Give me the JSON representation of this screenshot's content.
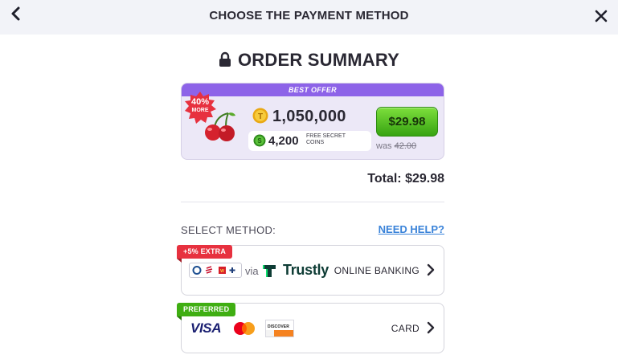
{
  "header": {
    "title": "CHOOSE THE PAYMENT METHOD",
    "back_icon": "chevron-left-icon",
    "close_icon": "close-icon"
  },
  "summary": {
    "title": "ORDER SUMMARY",
    "lock_icon": "lock-icon"
  },
  "offer": {
    "banner": "BEST OFFER",
    "promo_percent": "40%",
    "promo_more": "MORE",
    "coins": "1,050,000",
    "bonus_coins": "4,200",
    "bonus_label": "FREE SECRET COINS",
    "price": "$29.98",
    "was_prefix": "was",
    "was_price": "42.00",
    "accent_color": "#8d63e8",
    "button_color": "#4cbb1c"
  },
  "total": {
    "label": "Total:",
    "amount": "$29.98"
  },
  "methods": {
    "section_label": "SELECT METHOD:",
    "help_link": "NEED HELP?",
    "items": [
      {
        "badge": "+5% EXTRA",
        "badge_color": "#e7313f",
        "via": "via",
        "brand": "Trustly",
        "label": "ONLINE BANKING"
      },
      {
        "badge": "PREFERRED",
        "badge_color": "#3fae12",
        "brands": [
          "VISA",
          "Mastercard",
          "DISCOVER"
        ],
        "label": "CARD"
      }
    ]
  }
}
